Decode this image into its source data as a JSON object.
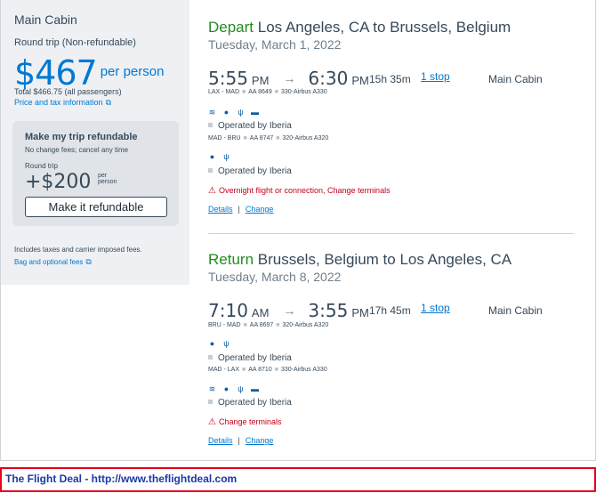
{
  "summary": {
    "cabin": "Main Cabin",
    "trip_type": "Round trip (Non-refundable)",
    "price": "$467",
    "per_person": "per person",
    "total": "Total $466.75 (all passengers)",
    "tax_link": "Price and tax information",
    "refund": {
      "title": "Make my trip refundable",
      "subtitle": "No change fees; cancel any time",
      "round_trip": "Round trip",
      "price": "+$200",
      "per": "per",
      "person": "person",
      "button": "Make it refundable"
    },
    "includes": "Includes taxes and carrier imposed fees.",
    "bag_link": "Bag and optional fees"
  },
  "depart": {
    "direction": "Depart",
    "route": "Los Angeles, CA to Brussels, Belgium",
    "date": "Tuesday, March 1, 2022",
    "dep_time": "5:55",
    "dep_ampm": "PM",
    "arr_time": "6:30",
    "arr_ampm": "PM",
    "duration": "15h 35m",
    "stops": "1 stop",
    "cabin": "Main Cabin",
    "legs": [
      {
        "route": "LAX - MAD",
        "flight": "AA 8649",
        "aircraft": "330-Airbus A330",
        "amenities": [
          "wifi-icon",
          "power-icon",
          "usb-icon",
          "entertainment-icon"
        ],
        "operated": "Operated by Iberia"
      },
      {
        "route": "MAD - BRU",
        "flight": "AA 8747",
        "aircraft": "320-Airbus A320",
        "amenities": [
          "power-icon",
          "usb-icon"
        ],
        "operated": "Operated by Iberia"
      }
    ],
    "warning": "Overnight flight or connection, Change terminals",
    "details": "Details",
    "change": "Change"
  },
  "return": {
    "direction": "Return",
    "route": "Brussels, Belgium to Los Angeles, CA",
    "date": "Tuesday, March 8, 2022",
    "dep_time": "7:10",
    "dep_ampm": "AM",
    "arr_time": "3:55",
    "arr_ampm": "PM",
    "duration": "17h 45m",
    "stops": "1 stop",
    "cabin": "Main Cabin",
    "legs": [
      {
        "route": "BRU - MAD",
        "flight": "AA 8697",
        "aircraft": "320-Airbus A320",
        "amenities": [
          "power-icon",
          "usb-icon"
        ],
        "operated": "Operated by Iberia"
      },
      {
        "route": "MAD - LAX",
        "flight": "AA 8710",
        "aircraft": "330-Airbus A330",
        "amenities": [
          "wifi-icon",
          "power-icon",
          "usb-icon",
          "entertainment-icon"
        ],
        "operated": "Operated by Iberia"
      }
    ],
    "warning": "Change terminals",
    "details": "Details",
    "change": "Change"
  },
  "footer": "The Flight Deal - http://www.theflightdeal.com",
  "colors": {
    "accent": "#0078d2",
    "direction": "#228b22",
    "warning": "#c30019",
    "footer_border": "#e8001c"
  }
}
